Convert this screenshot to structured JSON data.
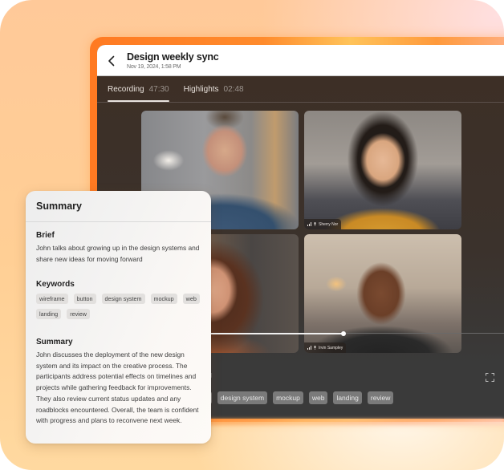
{
  "meeting": {
    "title": "Design weekly sync",
    "datetime": "Nov 19, 2024, 1:58 PM"
  },
  "tabs": [
    {
      "label": "Recording",
      "duration": "47:30",
      "active": true
    },
    {
      "label": "Highlights",
      "duration": "02:48",
      "active": false
    }
  ],
  "participants": [
    {
      "name": "",
      "tile": "top-left"
    },
    {
      "name": "Sherry Nor",
      "tile": "top-right"
    },
    {
      "name": "",
      "tile": "bottom-left"
    },
    {
      "name": "Irvin Sampley",
      "tile": "bottom-right"
    }
  ],
  "playback": {
    "progress_percent": 59,
    "label_partial": "ording"
  },
  "window_keywords": [
    "n",
    "design system",
    "mockup",
    "web",
    "landing",
    "review"
  ],
  "summary_card": {
    "title": "Summary",
    "brief_heading": "Brief",
    "brief_text": "John talks about growing up in the design systems and share new ideas for moving forward",
    "keywords_heading": "Keywords",
    "keywords": [
      "wireframe",
      "button",
      "design system",
      "mockup",
      "web",
      "landing",
      "review"
    ],
    "summary_heading": "Summary",
    "summary_text": "John discusses the deployment of the new design system and its impact on the creative process. The participants address potential effects on timelines and projects while gathering feedback for improvements. They also review current status updates and any roadblocks encountered. Overall, the team is confident with progress and plans to reconvene next week."
  },
  "icons": {
    "back": "chevron-left-icon",
    "fullscreen": "fullscreen-icon",
    "signal": "signal-bars-icon",
    "mic": "microphone-icon"
  },
  "colors": {
    "accent_orange": "#ff7a22",
    "window_dark": "#3a3a3a",
    "stage_top": "#3d2f26"
  }
}
